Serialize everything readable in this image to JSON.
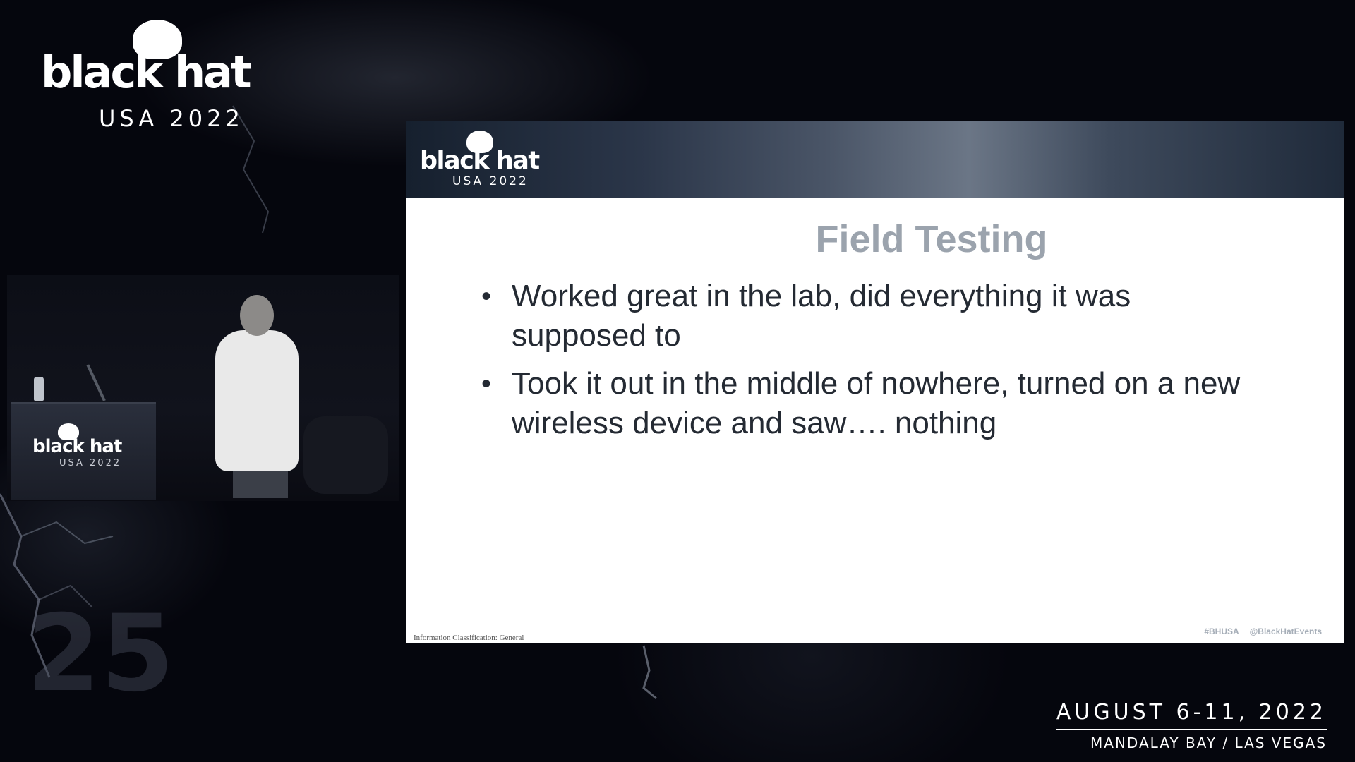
{
  "branding": {
    "wordmark": "black hat",
    "edition": "USA 2022"
  },
  "slide": {
    "title": "Field Testing",
    "bullets": [
      "Worked great in the lab, did everything it was supposed to",
      "Took it out in the middle of nowhere, turned on a new wireless device and saw…. nothing"
    ],
    "classification": "Information Classification: General",
    "hashtag": "#BHUSA",
    "handle": "@BlackHatEvents"
  },
  "event": {
    "dates": "AUGUST 6-11, 2022",
    "venue": "MANDALAY BAY / LAS VEGAS"
  },
  "decor": {
    "big_number": "25"
  },
  "colors": {
    "background": "#05060d",
    "slide_title": "#9ba3ad",
    "slide_text": "#242a33"
  }
}
